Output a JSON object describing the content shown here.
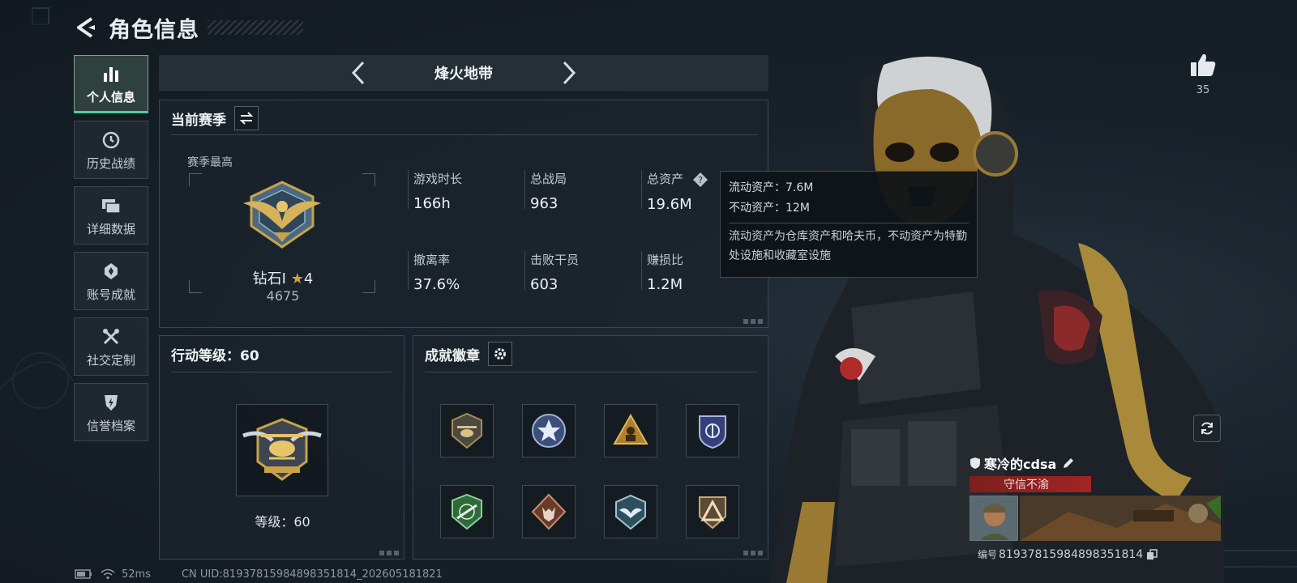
{
  "header": {
    "title": "角色信息"
  },
  "sidebar": {
    "items": [
      {
        "label": "个人信息",
        "icon": "bar-chart-icon",
        "active": true
      },
      {
        "label": "历史战绩",
        "icon": "clock-icon"
      },
      {
        "label": "详细数据",
        "icon": "cards-icon"
      },
      {
        "label": "账号成就",
        "icon": "achievement-icon"
      },
      {
        "label": "社交定制",
        "icon": "tools-icon"
      },
      {
        "label": "信誉档案",
        "icon": "lightning-shield-icon"
      }
    ]
  },
  "mode": {
    "title": "烽火地带"
  },
  "season": {
    "title": "当前赛季",
    "subtitle": "赛季最高",
    "rank_name": "钻石Ⅰ",
    "rank_stars": "4",
    "rank_score": "4675",
    "stats": [
      {
        "label": "游戏时长",
        "value": "166h"
      },
      {
        "label": "总战局",
        "value": "963"
      },
      {
        "label": "总资产",
        "value": "19.6M"
      },
      {
        "label": "撤离率",
        "value": "37.6%"
      },
      {
        "label": "击败干员",
        "value": "603"
      },
      {
        "label": "赚损比",
        "value": "1.2M"
      }
    ]
  },
  "tooltip": {
    "liquid": "流动资产：7.6M",
    "fixed": "不动资产：12M",
    "note": "流动资产为仓库资产和哈夫币，不动资产为特勤处设施和收藏室设施"
  },
  "level": {
    "title": "行动等级：60",
    "text": "等级：60"
  },
  "badges": {
    "title": "成就徽章",
    "items": [
      "helicopter-badge",
      "star-badge",
      "triangle-soldier-badge",
      "shield-badge",
      "rifle-badge",
      "wolf-badge",
      "wings-badge",
      "triangle-badge"
    ]
  },
  "like": {
    "count": "35"
  },
  "player": {
    "name": "寒冷的cdsa",
    "tag": "守信不渝",
    "id_label": "编号",
    "id": "8193781598489835181​4"
  },
  "status": {
    "ping": "52ms",
    "uid": "CN UID:8193781598489835181​4_202605181821"
  },
  "colors": {
    "accent": "#4fd19a",
    "tag_red": "#a32424",
    "gold": "#c9a24a"
  }
}
